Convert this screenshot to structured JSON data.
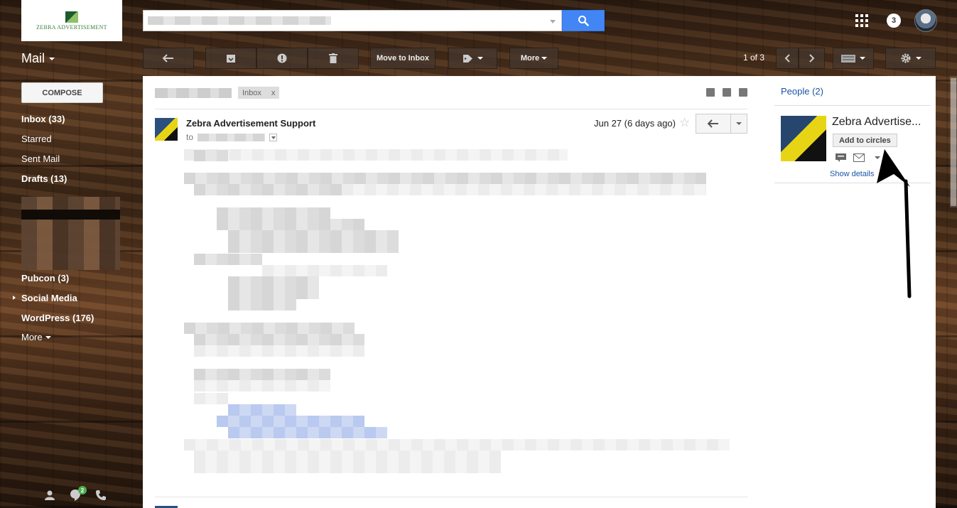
{
  "brand": {
    "logo_text": "ZEBRA ADVERTISEMENT"
  },
  "header": {
    "notification_count": "3"
  },
  "mail_menu": {
    "label": "Mail"
  },
  "toolbar": {
    "move_to_inbox": "Move to Inbox",
    "more": "More",
    "pager": "1 of 3"
  },
  "sidebar": {
    "compose": "COMPOSE",
    "items": [
      {
        "label": "Inbox (33)",
        "bold": true
      },
      {
        "label": "Starred",
        "bold": false
      },
      {
        "label": "Sent Mail",
        "bold": false
      },
      {
        "label": "Drafts (13)",
        "bold": true
      },
      {
        "label": "Pubcon (3)",
        "bold": true
      },
      {
        "label": "Social Media",
        "bold": true
      },
      {
        "label": "WordPress (176)",
        "bold": true
      },
      {
        "label": "More",
        "bold": false
      }
    ],
    "hangouts_badge": "2"
  },
  "thread": {
    "label_tag": "Inbox",
    "label_remove": "x",
    "sender": "Zebra Advertisement Support",
    "to_prefix": "to",
    "date": "Jun 27 (6 days ago)"
  },
  "people": {
    "title": "People (2)",
    "name": "Zebra Advertise...",
    "add_to_circles": "Add to circles",
    "show_details": "Show details"
  },
  "colors": {
    "accent_blue": "#4285f4",
    "link_blue": "#1a55a5"
  }
}
